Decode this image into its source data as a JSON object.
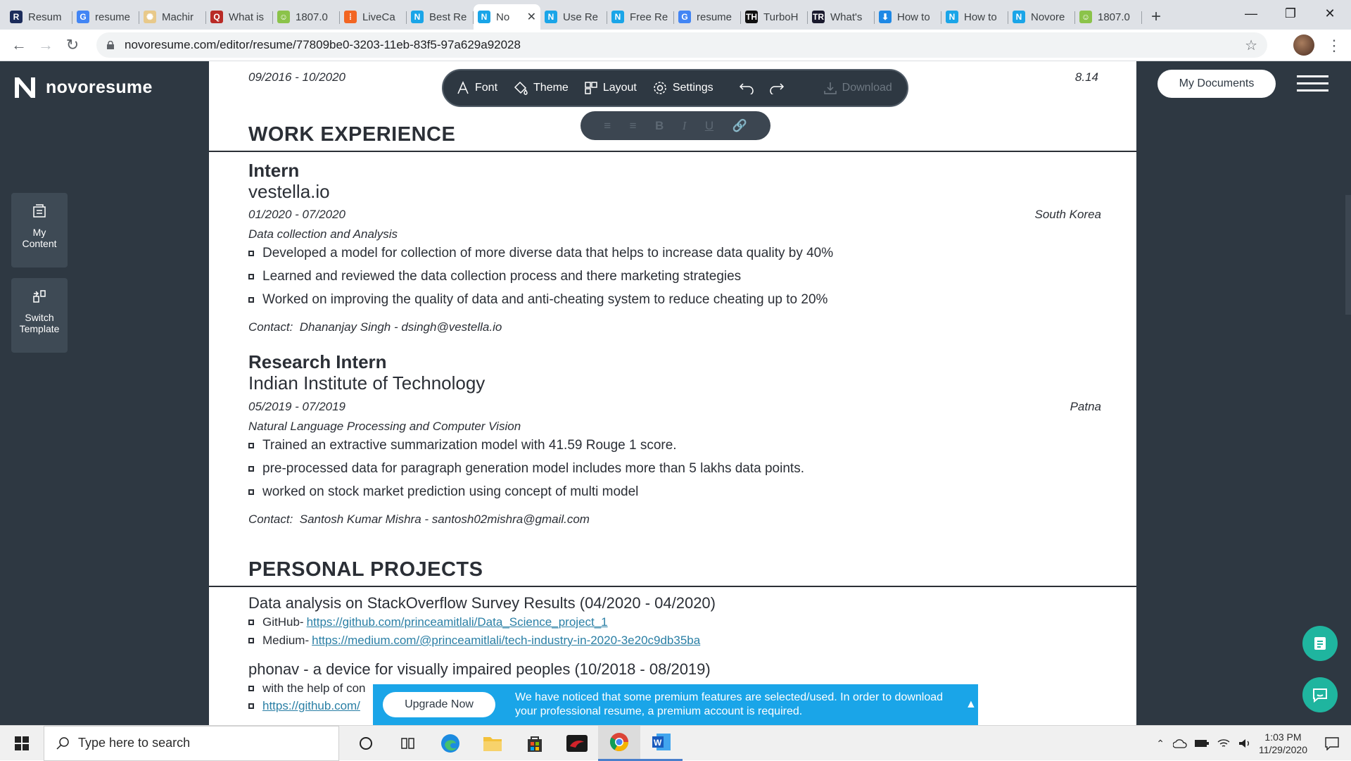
{
  "browser": {
    "tabs": [
      {
        "title": "Resum",
        "fav": "R",
        "color": "#1c2c5b"
      },
      {
        "title": "resume",
        "fav": "G",
        "color": "#4285f4"
      },
      {
        "title": "Machir",
        "fav": "✺",
        "color": "#e8c98a"
      },
      {
        "title": "What is",
        "fav": "Q",
        "color": "#b92b27"
      },
      {
        "title": "1807.0",
        "fav": "☺",
        "color": "#8bc34a"
      },
      {
        "title": "LiveCa",
        "fav": "⁞",
        "color": "#f26522"
      },
      {
        "title": "Best Re",
        "fav": "N",
        "color": "#1aa5e8"
      },
      {
        "title": "No",
        "fav": "N",
        "color": "#1aa5e8",
        "active": true
      },
      {
        "title": "Use Re",
        "fav": "N",
        "color": "#1aa5e8"
      },
      {
        "title": "Free Re",
        "fav": "N",
        "color": "#1aa5e8"
      },
      {
        "title": "resume",
        "fav": "G",
        "color": "#4285f4"
      },
      {
        "title": "TurboH",
        "fav": "TH",
        "color": "#111111"
      },
      {
        "title": "What's",
        "fav": "TR",
        "color": "#1a1a2e"
      },
      {
        "title": "How to",
        "fav": "⬇",
        "color": "#1e88e5"
      },
      {
        "title": "How to",
        "fav": "N",
        "color": "#1aa5e8"
      },
      {
        "title": "Novore",
        "fav": "N",
        "color": "#1aa5e8"
      },
      {
        "title": "1807.0",
        "fav": "☺",
        "color": "#8bc34a"
      }
    ],
    "new_tab": "+",
    "url": "novoresume.com/editor/resume/77809be0-3203-11eb-83f5-97a629a92028"
  },
  "app": {
    "logo": "novoresume",
    "side_buttons": [
      {
        "label1": "My",
        "label2": "Content"
      },
      {
        "label1": "Switch",
        "label2": "Template"
      }
    ],
    "my_documents": "My Documents",
    "toolbar": {
      "font": "Font",
      "theme": "Theme",
      "layout": "Layout",
      "settings": "Settings",
      "download": "Download"
    },
    "format": {
      "bold": "B",
      "italic": "I",
      "underline": "U"
    }
  },
  "resume": {
    "prev_date": "09/2016 - 10/2020",
    "prev_score": "8.14",
    "work_heading": "WORK EXPERIENCE",
    "jobs": [
      {
        "title": "Intern",
        "company": "vestella.io",
        "date": "01/2020 - 07/2020",
        "location": "South Korea",
        "desc": "Data collection and Analysis",
        "bullets": [
          "Developed a model for collection of more diverse data that helps to increase data quality by 40%",
          "Learned and reviewed the data collection process and there marketing strategies",
          "Worked on improving the quality of data and anti-cheating system to reduce cheating up to 20%"
        ],
        "contact_label": "Contact:",
        "contact": "Dhananjay Singh - dsingh@vestella.io"
      },
      {
        "title": "Research Intern",
        "company": "Indian Institute of Technology",
        "date": "05/2019 - 07/2019",
        "location": "Patna",
        "desc": "Natural Language Processing and Computer Vision",
        "bullets": [
          "Trained an extractive summarization model with 41.59 Rouge 1 score.",
          "pre-processed data for paragraph generation model includes more than 5 lakhs data points.",
          "worked on stock market prediction using concept of multi model"
        ],
        "contact_label": "Contact:",
        "contact": "Santosh Kumar Mishra - santosh02mishra@gmail.com"
      }
    ],
    "projects_heading": "PERSONAL PROJECTS",
    "projects": [
      {
        "title": "Data analysis on StackOverflow Survey Results (04/2020 - 04/2020)",
        "links": [
          {
            "label": "GitHub-",
            "url": "https://github.com/princeamitlali/Data_Science_project_1"
          },
          {
            "label": "Medium-",
            "url": "https://medium.com/@princeamitlali/tech-industry-in-2020-3e20c9db35ba"
          }
        ]
      },
      {
        "title": "phonav - a device for visually impaired peoples (10/2018 - 08/2019)",
        "lines": [
          "with the help of con",
          "https://github.com/"
        ]
      }
    ]
  },
  "banner": {
    "button": "Upgrade Now",
    "message": "We have noticed that some premium features are selected/used. In order to download your professional resume, a premium account is required."
  },
  "taskbar": {
    "search_placeholder": "Type here to search",
    "time": "1:03 PM",
    "date": "11/29/2020"
  }
}
